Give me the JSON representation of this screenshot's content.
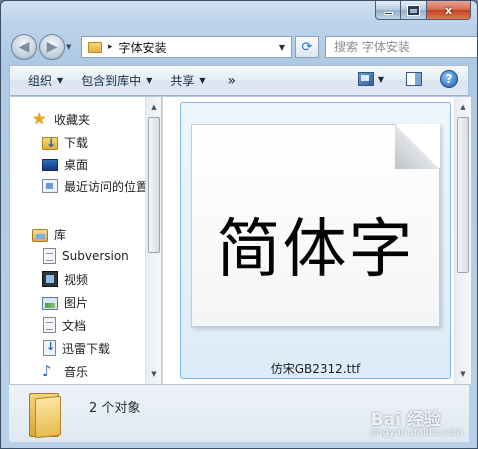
{
  "window": {
    "caption": {
      "min": "",
      "max": "",
      "close": "x"
    }
  },
  "address": {
    "path": "字体安装",
    "search_placeholder": "搜索 字体安装"
  },
  "toolbar": {
    "organize": "组织",
    "include_in_library": "包含到库中",
    "share": "共享",
    "more": "»"
  },
  "nav": {
    "favorites_header": "收藏夹",
    "favorites": [
      "下载",
      "桌面",
      "最近访问的位置"
    ],
    "libraries_header": "库",
    "libraries": [
      "Subversion",
      "视频",
      "图片",
      "文档",
      "迅雷下载",
      "音乐"
    ]
  },
  "content": {
    "preview_glyphs": "简体字",
    "file_name": "仿宋GB2312.ttf"
  },
  "status": {
    "count_text": "2 个对象"
  },
  "watermark": {
    "brand": "Bai 经验",
    "sub": "jingyan.baidu.com"
  },
  "icons": {
    "back": "back-arrow-icon",
    "forward": "forward-arrow-icon",
    "refresh": "refresh-icon",
    "search": "search-icon",
    "help": "help-icon"
  }
}
